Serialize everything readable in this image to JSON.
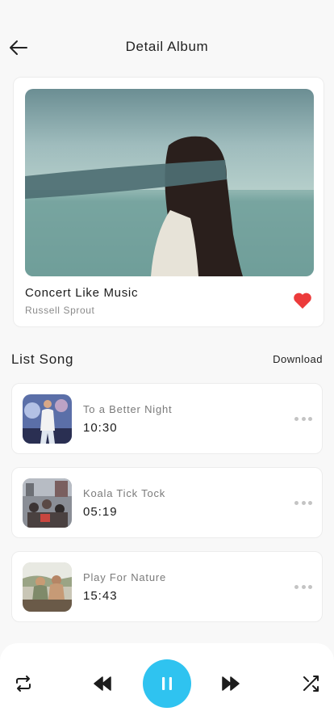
{
  "header": {
    "title": "Detail Album"
  },
  "album": {
    "title": "Concert Like Music",
    "artist": "Russell Sprout",
    "favorite": true
  },
  "section": {
    "title": "List Song",
    "download_label": "Download"
  },
  "songs": [
    {
      "title": "To a Better Night",
      "duration": "10:30"
    },
    {
      "title": "Koala Tick Tock",
      "duration": "05:19"
    },
    {
      "title": "Play For Nature",
      "duration": "15:43"
    }
  ],
  "player": {
    "controls": [
      "repeat-icon",
      "rewind-icon",
      "pause-icon",
      "fast-forward-icon",
      "shuffle-icon"
    ],
    "accent": "#2fc3f0"
  },
  "colors": {
    "heart": "#ec3b3b",
    "background": "#f8f8f8"
  }
}
